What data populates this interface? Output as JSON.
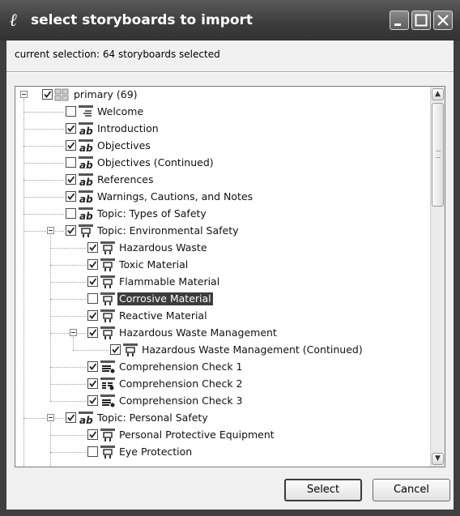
{
  "window": {
    "icon_glyph": "ℓ",
    "title": "select storyboards to import",
    "controls": [
      "minimize-icon",
      "maximize-icon",
      "close-icon"
    ]
  },
  "selection_summary": "current selection:  64 storyboards selected",
  "tree": {
    "root": {
      "label": "primary (69)",
      "checked": true,
      "icon": "folder-grid-icon"
    },
    "items": [
      {
        "label": "Welcome",
        "depth": 1,
        "checked": false,
        "icon": "page-lines-icon"
      },
      {
        "label": "Introduction",
        "depth": 1,
        "checked": true,
        "icon": "text-ab-icon"
      },
      {
        "label": "Objectives",
        "depth": 1,
        "checked": true,
        "icon": "text-ab-icon"
      },
      {
        "label": "Objectives (Continued)",
        "depth": 1,
        "checked": false,
        "icon": "text-ab-icon"
      },
      {
        "label": "References",
        "depth": 1,
        "checked": true,
        "icon": "text-ab-icon"
      },
      {
        "label": "Warnings, Cautions, and Notes",
        "depth": 1,
        "checked": true,
        "icon": "text-ab-icon"
      },
      {
        "label": "Topic: Types of Safety",
        "depth": 1,
        "checked": false,
        "icon": "text-ab-icon"
      },
      {
        "label": "Topic: Environmental Safety",
        "depth": 1,
        "checked": true,
        "icon": "media-page-icon",
        "expanded": true
      },
      {
        "label": "Hazardous Waste",
        "depth": 2,
        "checked": true,
        "icon": "media-page-icon"
      },
      {
        "label": "Toxic Material",
        "depth": 2,
        "checked": true,
        "icon": "media-page-icon"
      },
      {
        "label": "Flammable Material",
        "depth": 2,
        "checked": true,
        "icon": "media-page-icon"
      },
      {
        "label": "Corrosive Material",
        "depth": 2,
        "checked": false,
        "icon": "media-page-icon",
        "selected": true
      },
      {
        "label": "Reactive Material",
        "depth": 2,
        "checked": true,
        "icon": "media-page-icon"
      },
      {
        "label": "Hazardous Waste Management",
        "depth": 2,
        "checked": true,
        "icon": "media-page-icon",
        "expanded": true
      },
      {
        "label": "Hazardous Waste Management (Continued)",
        "depth": 3,
        "checked": true,
        "icon": "media-page-icon"
      },
      {
        "label": "Comprehension Check 1",
        "depth": 2,
        "checked": true,
        "icon": "quiz-list-icon"
      },
      {
        "label": "Comprehension Check 2",
        "depth": 2,
        "checked": true,
        "icon": "quiz-grid-icon"
      },
      {
        "label": "Comprehension Check 3",
        "depth": 2,
        "checked": true,
        "icon": "quiz-list-icon"
      },
      {
        "label": "Topic: Personal Safety",
        "depth": 1,
        "checked": true,
        "icon": "text-ab-icon",
        "expanded": true
      },
      {
        "label": "Personal Protective Equipment",
        "depth": 2,
        "checked": true,
        "icon": "media-page-icon"
      },
      {
        "label": "Eye Protection",
        "depth": 2,
        "checked": false,
        "icon": "media-page-icon"
      }
    ]
  },
  "scrollbar": {
    "up": "▲",
    "down": "▼",
    "position": 0.0
  },
  "buttons": {
    "select": "Select",
    "cancel": "Cancel"
  }
}
